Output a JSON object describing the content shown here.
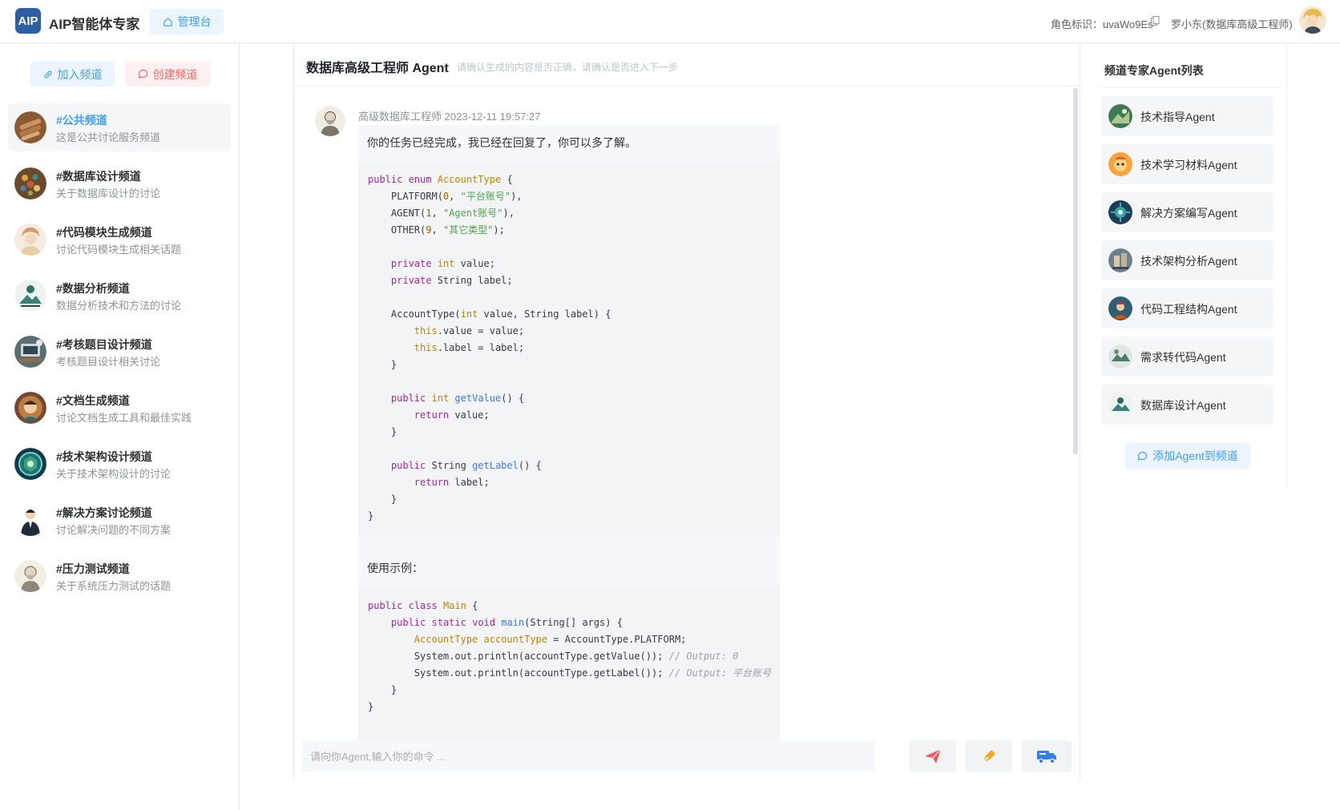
{
  "header": {
    "logo_text": "AIP",
    "app_title": "AIP智能体专家",
    "admin_tab": "管理台",
    "role_id": "角色标识：uvaWo9Es",
    "user_name": "罗小东(数据库高级工程师)"
  },
  "sidebar": {
    "join_label": "加入频道",
    "create_label": "创建频道",
    "channels": [
      {
        "name": "#公共频道",
        "desc": "这是公共讨论服务频道",
        "active": true
      },
      {
        "name": "#数据库设计频道",
        "desc": "关于数据库设计的讨论"
      },
      {
        "name": "#代码模块生成频道",
        "desc": "讨论代码模块生成相关话题"
      },
      {
        "name": "#数据分析频道",
        "desc": "数据分析技术和方法的讨论"
      },
      {
        "name": "#考核题目设计频道",
        "desc": "考核题目设计相关讨论"
      },
      {
        "name": "#文档生成频道",
        "desc": "讨论文档生成工具和最佳实践"
      },
      {
        "name": "#技术架构设计频道",
        "desc": "关于技术架构设计的讨论"
      },
      {
        "name": "#解决方案讨论频道",
        "desc": "讨论解决问题的不同方案"
      },
      {
        "name": "#压力测试频道",
        "desc": "关于系统压力测试的话题"
      }
    ]
  },
  "chat": {
    "title": "数据库高级工程师 Agent",
    "hint": "请确认生成的内容是否正确，请确认是否进入下一步",
    "message": {
      "author": "高级数据库工程师",
      "time": "2023-12-11 19:57:27",
      "text": "你的任务已经完成，我已经在回复了，你可以多了解。",
      "usage_label": "使用示例："
    },
    "input_placeholder": "请向你Agent,输入你的命令 ..."
  },
  "agents_panel": {
    "title": "频道专家Agent列表",
    "agents": [
      "技术指导Agent",
      "技术学习材料Agent",
      "解决方案编写Agent",
      "技术架构分析Agent",
      "代码工程结构Agent",
      "需求转代码Agent",
      "数据库设计Agent"
    ],
    "add_label": "添加Agent到频道"
  },
  "colors": {
    "primary": "#409eff",
    "danger": "#f56c6c",
    "logo": "#2c5ea6"
  },
  "icons": [
    "home-icon",
    "copy-icon",
    "link-icon",
    "chat-bubble-icon",
    "send-icon",
    "pen-icon",
    "truck-icon"
  ]
}
